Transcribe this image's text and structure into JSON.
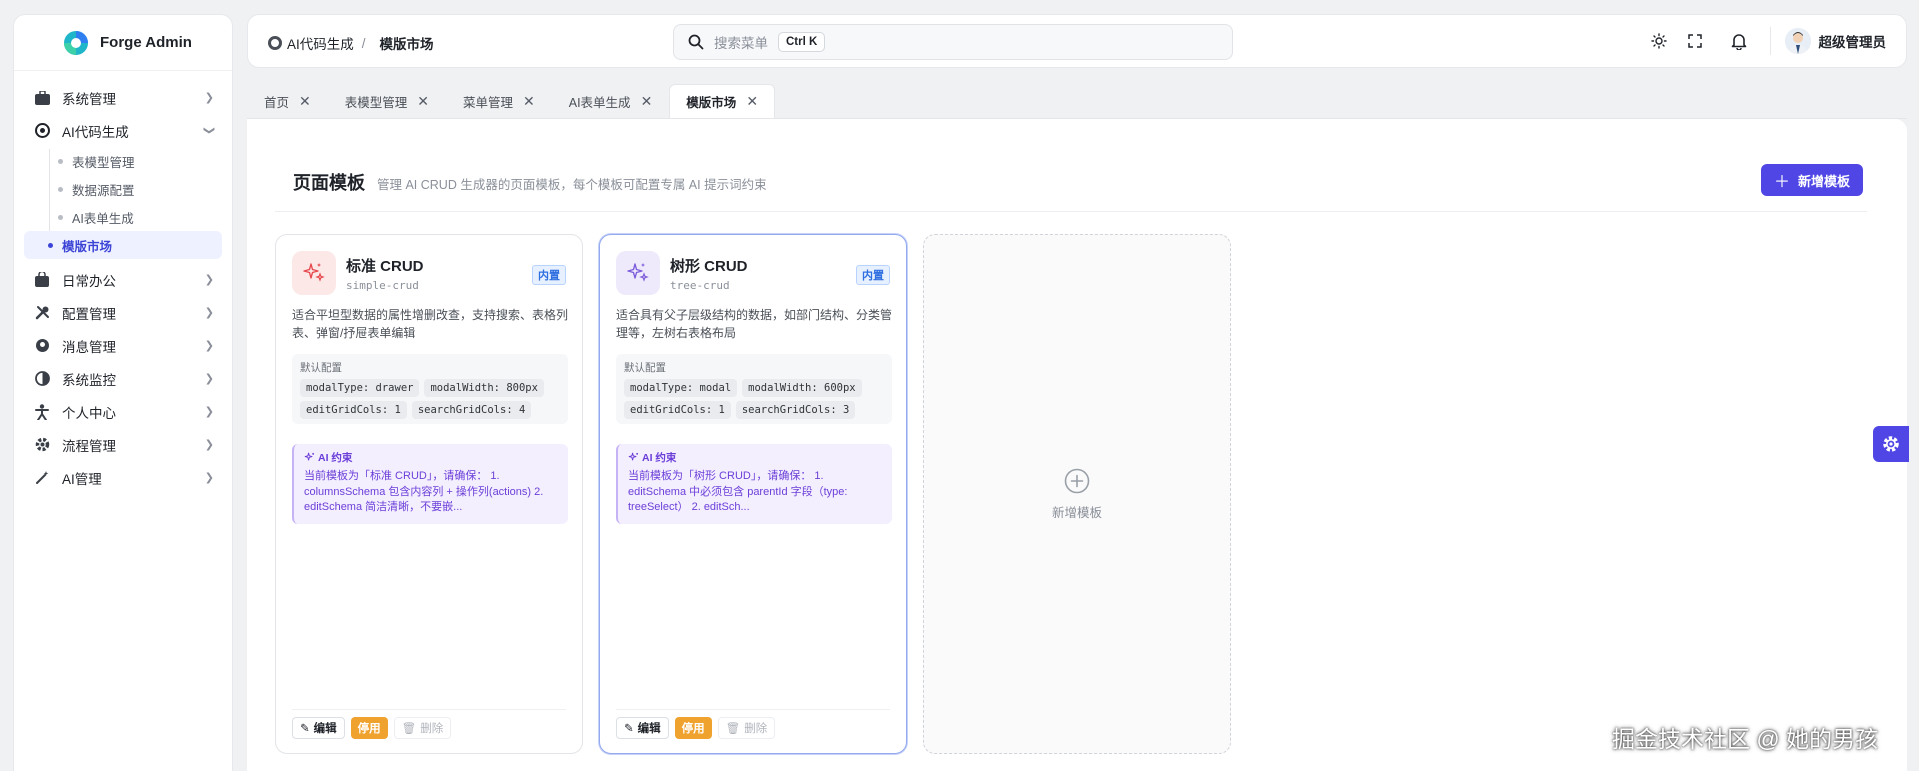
{
  "app": {
    "name": "Forge Admin"
  },
  "sidebar": {
    "items": [
      {
        "label": "系统管理",
        "icon": "briefcase-icon"
      },
      {
        "label": "AI代码生成",
        "icon": "openai-icon",
        "expanded": true,
        "children": [
          {
            "label": "表模型管理"
          },
          {
            "label": "数据源配置"
          },
          {
            "label": "AI表单生成"
          },
          {
            "label": "模版市场",
            "active": true
          }
        ]
      },
      {
        "label": "日常办公",
        "icon": "bag-icon"
      },
      {
        "label": "配置管理",
        "icon": "tools-icon"
      },
      {
        "label": "消息管理",
        "icon": "message-icon"
      },
      {
        "label": "系统监控",
        "icon": "monitor-icon"
      },
      {
        "label": "个人中心",
        "icon": "person-icon"
      },
      {
        "label": "流程管理",
        "icon": "cog-icon"
      },
      {
        "label": "AI管理",
        "icon": "wand-icon"
      }
    ]
  },
  "header": {
    "breadcrumb": {
      "parent": "AI代码生成",
      "separator": "/",
      "current": "模版市场"
    },
    "search": {
      "placeholder": "搜索菜单",
      "shortcut": "Ctrl K"
    },
    "user": {
      "name": "超级管理员"
    }
  },
  "tabs": [
    {
      "label": "首页"
    },
    {
      "label": "表模型管理"
    },
    {
      "label": "菜单管理"
    },
    {
      "label": "AI表单生成"
    },
    {
      "label": "模版市场",
      "active": true
    }
  ],
  "page": {
    "title": "页面模板",
    "description": "管理 AI CRUD 生成器的页面模板，每个模板可配置专属 AI 提示词约束",
    "add_button": "新增模板"
  },
  "cards": [
    {
      "name": "标准 CRUD",
      "key": "simple-crud",
      "badge": "内置",
      "icon_color": "#e5484d",
      "icon_bg": "#fde8e8",
      "description": "适合平坦型数据的属性增删改查，支持搜索、表格列表、弹窗/抒屉表单编辑",
      "config_title": "默认配置",
      "config": [
        "modalType: drawer",
        "modalWidth: 800px",
        "editGridCols: 1",
        "searchGridCols: 4"
      ],
      "ai_title": "AI 约束",
      "ai_text": "当前模板为「标准 CRUD」，请确保： 1. columnsSchema 包含内容列 + 操作列(actions) 2. editSchema 简洁清晰，不要嵌...",
      "actions": {
        "edit": "编辑",
        "disable": "停用",
        "delete": "删除"
      }
    },
    {
      "name": "树形 CRUD",
      "key": "tree-crud",
      "badge": "内置",
      "icon_color": "#7c5cdb",
      "icon_bg": "#efe9fc",
      "description": "适合具有父子层级结构的数据，如部门结构、分类管理等，左树右表格布局",
      "config_title": "默认配置",
      "config": [
        "modalType: modal",
        "modalWidth: 600px",
        "editGridCols: 1",
        "searchGridCols: 3"
      ],
      "ai_title": "AI 约束",
      "ai_text": "当前模板为「树形 CRUD」，请确保： 1. editSchema 中必须包含 parentId 字段（type: treeSelect） 2. editSch...",
      "actions": {
        "edit": "编辑",
        "disable": "停用",
        "delete": "删除"
      }
    }
  ],
  "new_card": {
    "label": "新增模板"
  },
  "overlay": {
    "credit": "掘金技术社区 @ 她的男孩"
  },
  "colors": {
    "accent": "#4f46e5",
    "badge_blue": "#2f6fe0",
    "warn": "#f0a22e",
    "ai_purple": "#6b3fd8"
  }
}
